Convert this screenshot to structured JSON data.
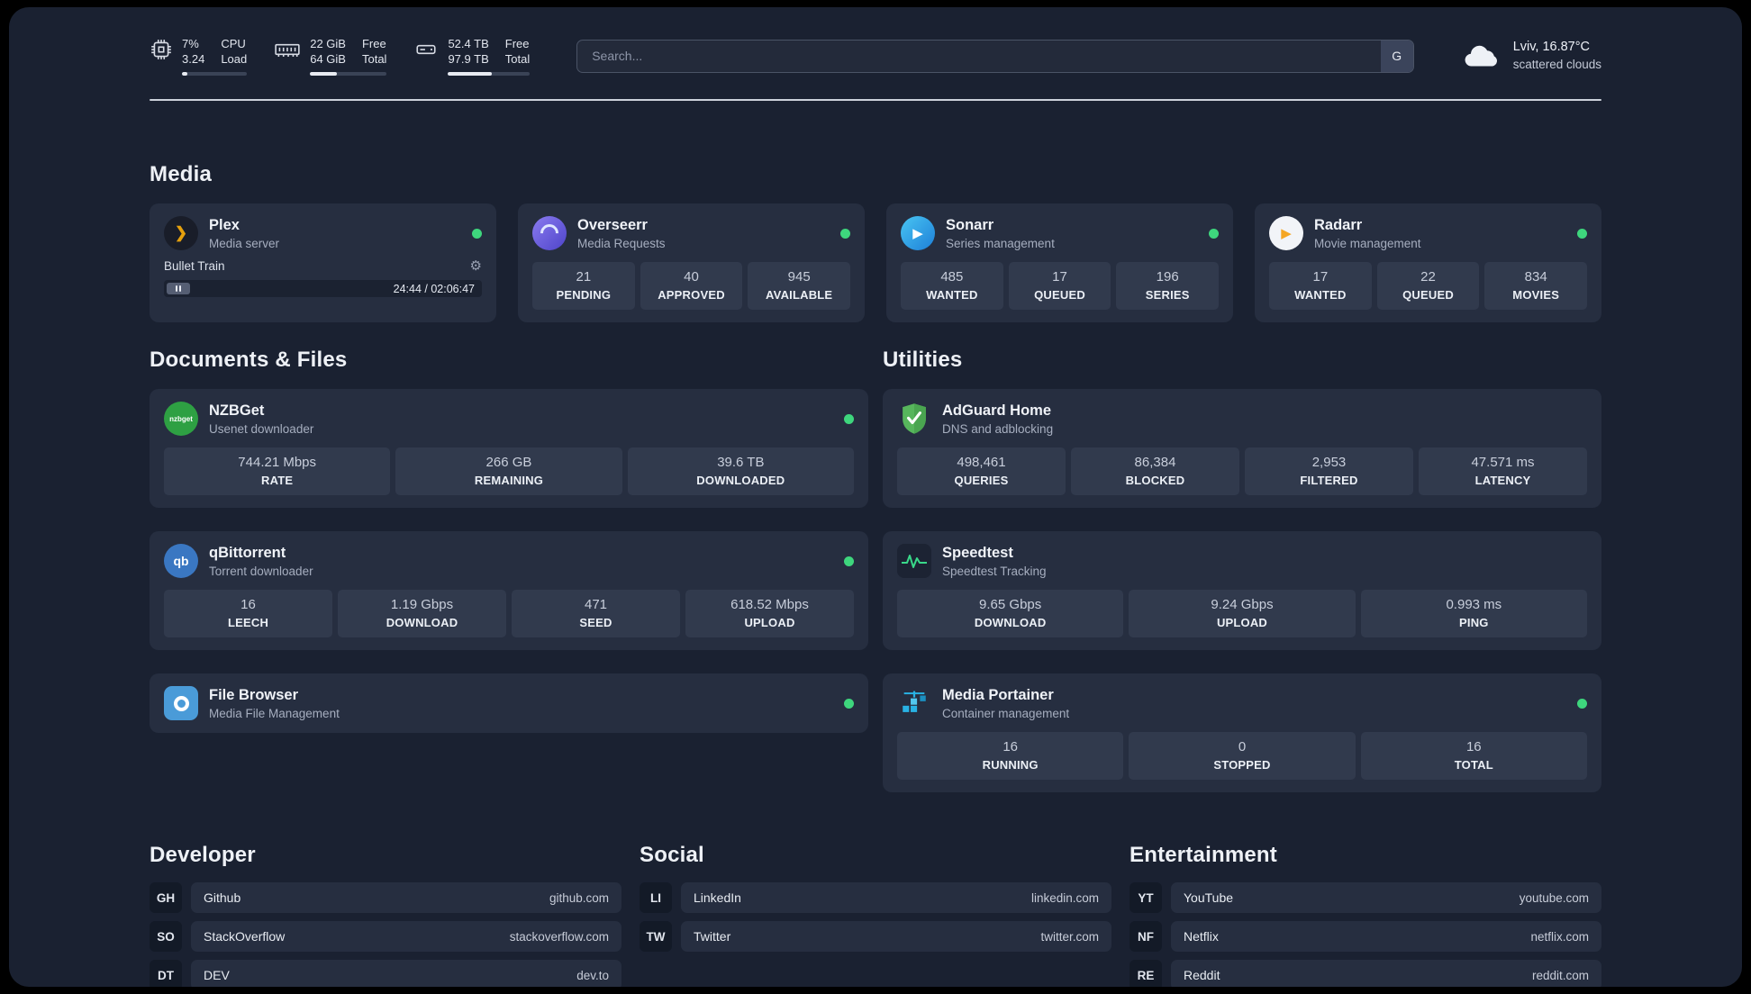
{
  "colors": {
    "page_bg": "#1a2131",
    "card_bg": "#262e40",
    "tile_bg": "#313a4d",
    "status_online": "#3ed67d",
    "accent_amber": "#e5a00d"
  },
  "icons": {
    "gear": "⚙",
    "plex": "❯",
    "sonarr": "▶",
    "radarr": "▶"
  },
  "topbar": {
    "cpu": {
      "value": "7%",
      "detail": "3.24",
      "label": "CPU",
      "label2": "Load"
    },
    "memory": {
      "value": "22 GiB",
      "detail": "64 GiB",
      "label": "Free",
      "label2": "Total"
    },
    "disk": {
      "value": "52.4 TB",
      "detail": "97.9 TB",
      "label": "Free",
      "label2": "Total"
    },
    "search": {
      "placeholder": "Search...",
      "button_label": "G"
    },
    "weather": {
      "location": "Lviv, 16.87°C",
      "condition": "scattered clouds"
    }
  },
  "media": {
    "title": "Media",
    "plex": {
      "name": "Plex",
      "subtitle": "Media server",
      "track": "Bullet Train",
      "time": "24:44 / 02:06:47"
    },
    "overseerr": {
      "name": "Overseerr",
      "subtitle": "Media Requests",
      "stats": [
        {
          "value": "21",
          "label": "PENDING"
        },
        {
          "value": "40",
          "label": "APPROVED"
        },
        {
          "value": "945",
          "label": "AVAILABLE"
        }
      ]
    },
    "sonarr": {
      "name": "Sonarr",
      "subtitle": "Series management",
      "stats": [
        {
          "value": "485",
          "label": "WANTED"
        },
        {
          "value": "17",
          "label": "QUEUED"
        },
        {
          "value": "196",
          "label": "SERIES"
        }
      ]
    },
    "radarr": {
      "name": "Radarr",
      "subtitle": "Movie management",
      "stats": [
        {
          "value": "17",
          "label": "WANTED"
        },
        {
          "value": "22",
          "label": "QUEUED"
        },
        {
          "value": "834",
          "label": "MOVIES"
        }
      ]
    }
  },
  "documents": {
    "title": "Documents & Files",
    "nzbget": {
      "name": "NZBGet",
      "subtitle": "Usenet downloader",
      "icon_text": "nzbget",
      "stats": [
        {
          "value": "744.21 Mbps",
          "label": "RATE"
        },
        {
          "value": "266 GB",
          "label": "REMAINING"
        },
        {
          "value": "39.6 TB",
          "label": "DOWNLOADED"
        }
      ]
    },
    "qbittorrent": {
      "name": "qBittorrent",
      "subtitle": "Torrent downloader",
      "icon_text": "qb",
      "stats": [
        {
          "value": "16",
          "label": "LEECH"
        },
        {
          "value": "1.19 Gbps",
          "label": "DOWNLOAD"
        },
        {
          "value": "471",
          "label": "SEED"
        },
        {
          "value": "618.52 Mbps",
          "label": "UPLOAD"
        }
      ]
    },
    "filebrowser": {
      "name": "File Browser",
      "subtitle": "Media File Management"
    }
  },
  "utilities": {
    "title": "Utilities",
    "adguard": {
      "name": "AdGuard Home",
      "subtitle": "DNS and adblocking",
      "stats": [
        {
          "value": "498,461",
          "label": "QUERIES"
        },
        {
          "value": "86,384",
          "label": "BLOCKED"
        },
        {
          "value": "2,953",
          "label": "FILTERED"
        },
        {
          "value": "47.571 ms",
          "label": "LATENCY"
        }
      ]
    },
    "speedtest": {
      "name": "Speedtest",
      "subtitle": "Speedtest Tracking",
      "stats": [
        {
          "value": "9.65 Gbps",
          "label": "DOWNLOAD"
        },
        {
          "value": "9.24 Gbps",
          "label": "UPLOAD"
        },
        {
          "value": "0.993 ms",
          "label": "PING"
        }
      ]
    },
    "portainer": {
      "name": "Media Portainer",
      "subtitle": "Container management",
      "stats": [
        {
          "value": "16",
          "label": "RUNNING"
        },
        {
          "value": "0",
          "label": "STOPPED"
        },
        {
          "value": "16",
          "label": "TOTAL"
        }
      ]
    }
  },
  "bookmarks": {
    "developer": {
      "title": "Developer",
      "items": [
        {
          "abbr": "GH",
          "name": "Github",
          "url": "github.com"
        },
        {
          "abbr": "SO",
          "name": "StackOverflow",
          "url": "stackoverflow.com"
        },
        {
          "abbr": "DT",
          "name": "DEV",
          "url": "dev.to"
        }
      ]
    },
    "social": {
      "title": "Social",
      "items": [
        {
          "abbr": "LI",
          "name": "LinkedIn",
          "url": "linkedin.com"
        },
        {
          "abbr": "TW",
          "name": "Twitter",
          "url": "twitter.com"
        }
      ]
    },
    "entertainment": {
      "title": "Entertainment",
      "items": [
        {
          "abbr": "YT",
          "name": "YouTube",
          "url": "youtube.com"
        },
        {
          "abbr": "NF",
          "name": "Netflix",
          "url": "netflix.com"
        },
        {
          "abbr": "RE",
          "name": "Reddit",
          "url": "reddit.com"
        }
      ]
    }
  }
}
